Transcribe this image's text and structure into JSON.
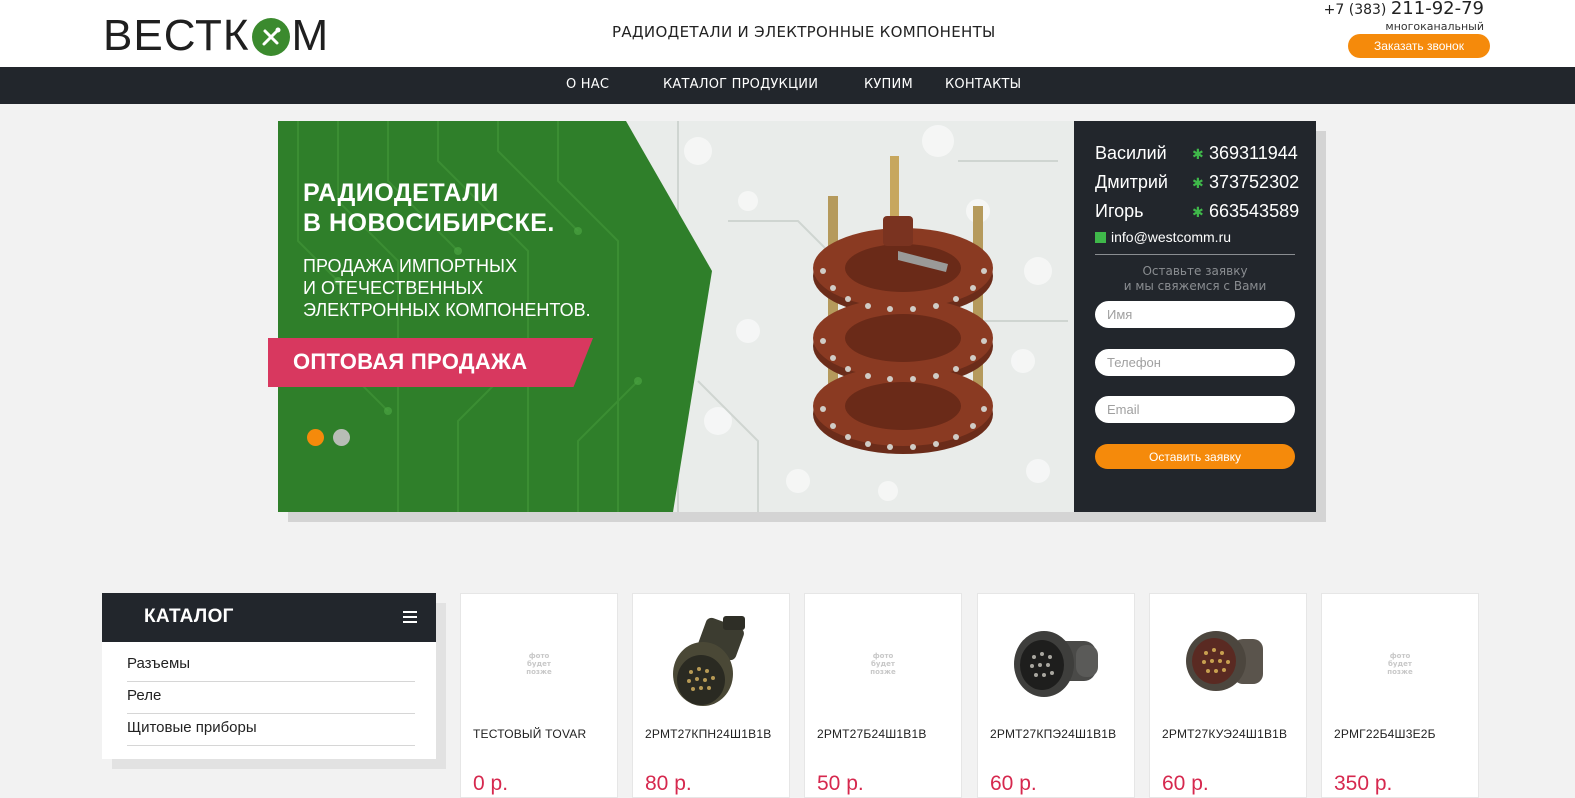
{
  "header": {
    "logo_text": "ВЕСТКОМ",
    "tagline": "РАДИОДЕТАЛИ И ЭЛЕКТРОННЫЕ КОМПОНЕНТЫ",
    "phone_prefix": "+7 (383)",
    "phone_number": "211-92-79",
    "phone_note": "многоканальный",
    "callback_label": "Заказать звонок"
  },
  "nav": {
    "items": [
      "О НАС",
      "КАТАЛОГ ПРОДУКЦИИ",
      "КУПИМ",
      "КОНТАКТЫ"
    ]
  },
  "banner": {
    "title_line1": "РАДИОДЕТАЛИ",
    "title_line2": "В НОВОСИБИРСКЕ.",
    "sub_line1": "ПРОДАЖА ИМПОРТНЫХ",
    "sub_line2": "И ОТЕЧЕСТВЕННЫХ",
    "sub_line3": "ЭЛЕКТРОННЫХ КОМПОНЕНТОВ.",
    "wholesale_label": "ОПТОВАЯ ПРОДАЖА",
    "active_slide": 1,
    "slide_count": 2
  },
  "contacts": {
    "people": [
      {
        "name": "Василий",
        "id": "369311944"
      },
      {
        "name": "Дмитрий",
        "id": "373752302"
      },
      {
        "name": "Игорь",
        "id": "663543589"
      }
    ],
    "email": "info@westcomm.ru",
    "note_line1": "Оставьте заявку",
    "note_line2": "и мы свяжемся с Вами",
    "name_placeholder": "Имя",
    "phone_placeholder": "Телефон",
    "email_placeholder": "Email",
    "submit_label": "Оставить заявку"
  },
  "catalog": {
    "title": "КАТАЛОГ",
    "items": [
      "Разъемы",
      "Реле",
      "Щитовые приборы"
    ]
  },
  "products": [
    {
      "name": "ТЕСТОВЫЙ TOVAR",
      "price": "0 р.",
      "image": "placeholder"
    },
    {
      "name": "2РМТ27КПН24Ш1В1В",
      "price": "80 р.",
      "image": "connector-straight"
    },
    {
      "name": "2РМТ27Б24Ш1В1В",
      "price": "50 р.",
      "image": "placeholder"
    },
    {
      "name": "2РМТ27КПЭ24Ш1В1В",
      "price": "60 р.",
      "image": "connector-angled"
    },
    {
      "name": "2РМТ27КУЭ24Ш1В1В",
      "price": "60 р.",
      "image": "connector-elbow"
    },
    {
      "name": "2РМГ22Б4Ш3Е2Б",
      "price": "350 р.",
      "image": "placeholder"
    }
  ],
  "placeholder_text": [
    "фото",
    "будет",
    "позже"
  ],
  "colors": {
    "dark": "#22262c",
    "accent_orange": "#f58a0b",
    "accent_pink": "#d8385f",
    "brand_green": "#3b8a2e",
    "price_red": "#d6284e"
  }
}
